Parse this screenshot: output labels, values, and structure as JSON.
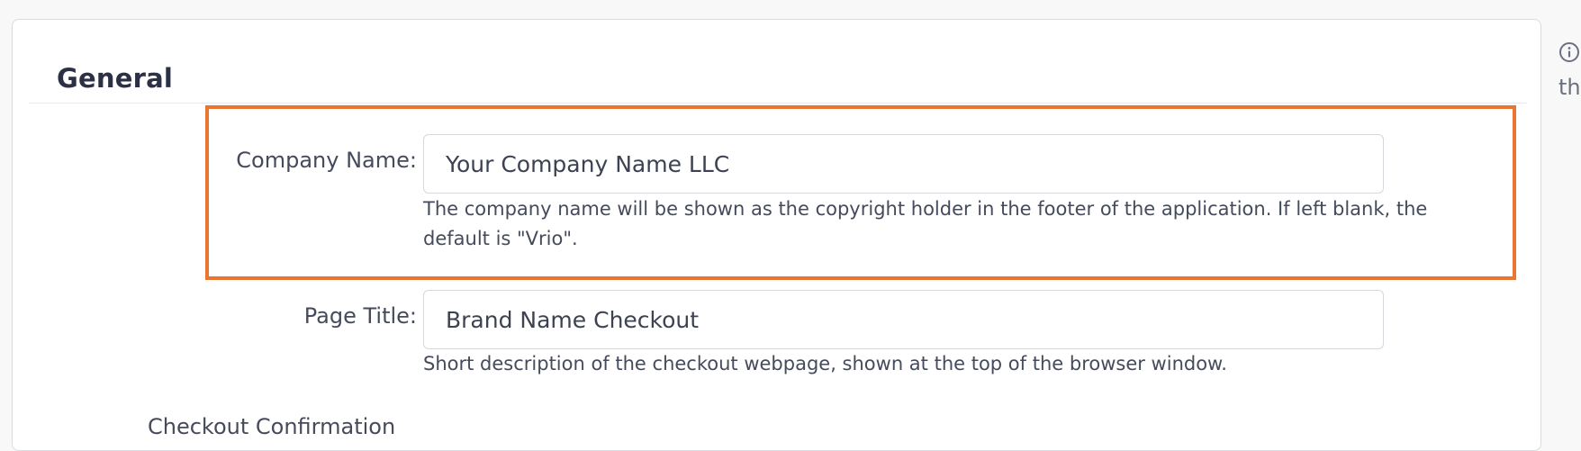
{
  "section": {
    "title": "General"
  },
  "company_name": {
    "label": "Company Name:",
    "value": "Your Company Name LLC",
    "help": "The company name will be shown as the copyright holder in the footer of the application. If left blank, the default is \"Vrio\"."
  },
  "page_title": {
    "label": "Page Title:",
    "value": "Brand Name Checkout",
    "help": "Short description of the checkout webpage, shown at the top of the browser window."
  },
  "next_field": {
    "label": "Checkout Confirmation"
  },
  "side_panel": {
    "icon": "info-icon",
    "text": "th"
  },
  "colors": {
    "highlight": "#ea7432",
    "title": "#2b3045",
    "text": "#454b5b"
  }
}
